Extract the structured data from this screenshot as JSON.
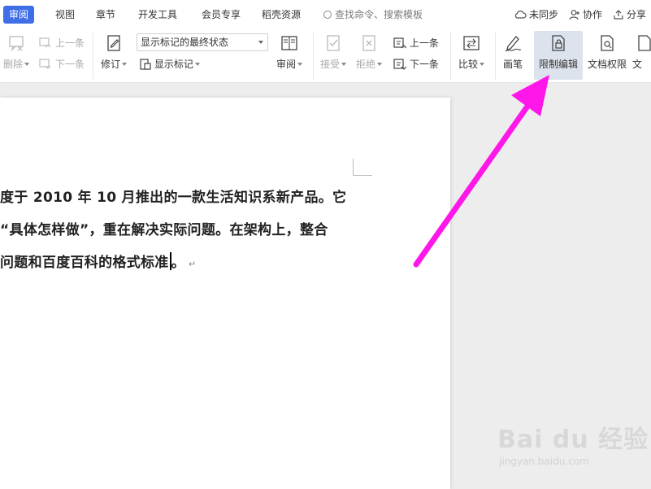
{
  "menu": {
    "tabs": [
      {
        "label": "审阅",
        "active": true
      },
      {
        "label": "视图"
      },
      {
        "label": "章节"
      },
      {
        "label": "开发工具"
      },
      {
        "label": "会员专享"
      },
      {
        "label": "稻壳资源"
      }
    ],
    "search_placeholder": "查找命令、搜索模板",
    "actions": {
      "sync": "未同步",
      "collab": "协作",
      "share": "分享"
    }
  },
  "ribbon": {
    "delete": "删除",
    "prev_comment": "上一条",
    "next_comment": "下一条",
    "revise": "修订",
    "markup_state": "显示标记的最终状态",
    "show_markup": "显示标记",
    "review": "审阅",
    "accept": "接受",
    "reject": "拒绝",
    "prev_change": "上一条",
    "next_change": "下一条",
    "compare": "比较",
    "ink": "画笔",
    "restrict_edit": "限制编辑",
    "doc_permission": "文档权限",
    "doc_cut": "文"
  },
  "document": {
    "lines": [
      "度于 2010 年 10 月推出的一款生活知识系新产品。它",
      "“具体怎样做”，重在解决实际问题。在架构上，整合",
      "问题和百度百科的格式标准"
    ],
    "line3_punct": "。",
    "para_mark": "↵"
  },
  "watermark": {
    "logo": "Bai du 经验",
    "sub": "jingyan.baidu.com"
  },
  "colors": {
    "accent": "#3f6fe6",
    "arrow": "#ff16e8",
    "highlight": "#dde3ec"
  }
}
